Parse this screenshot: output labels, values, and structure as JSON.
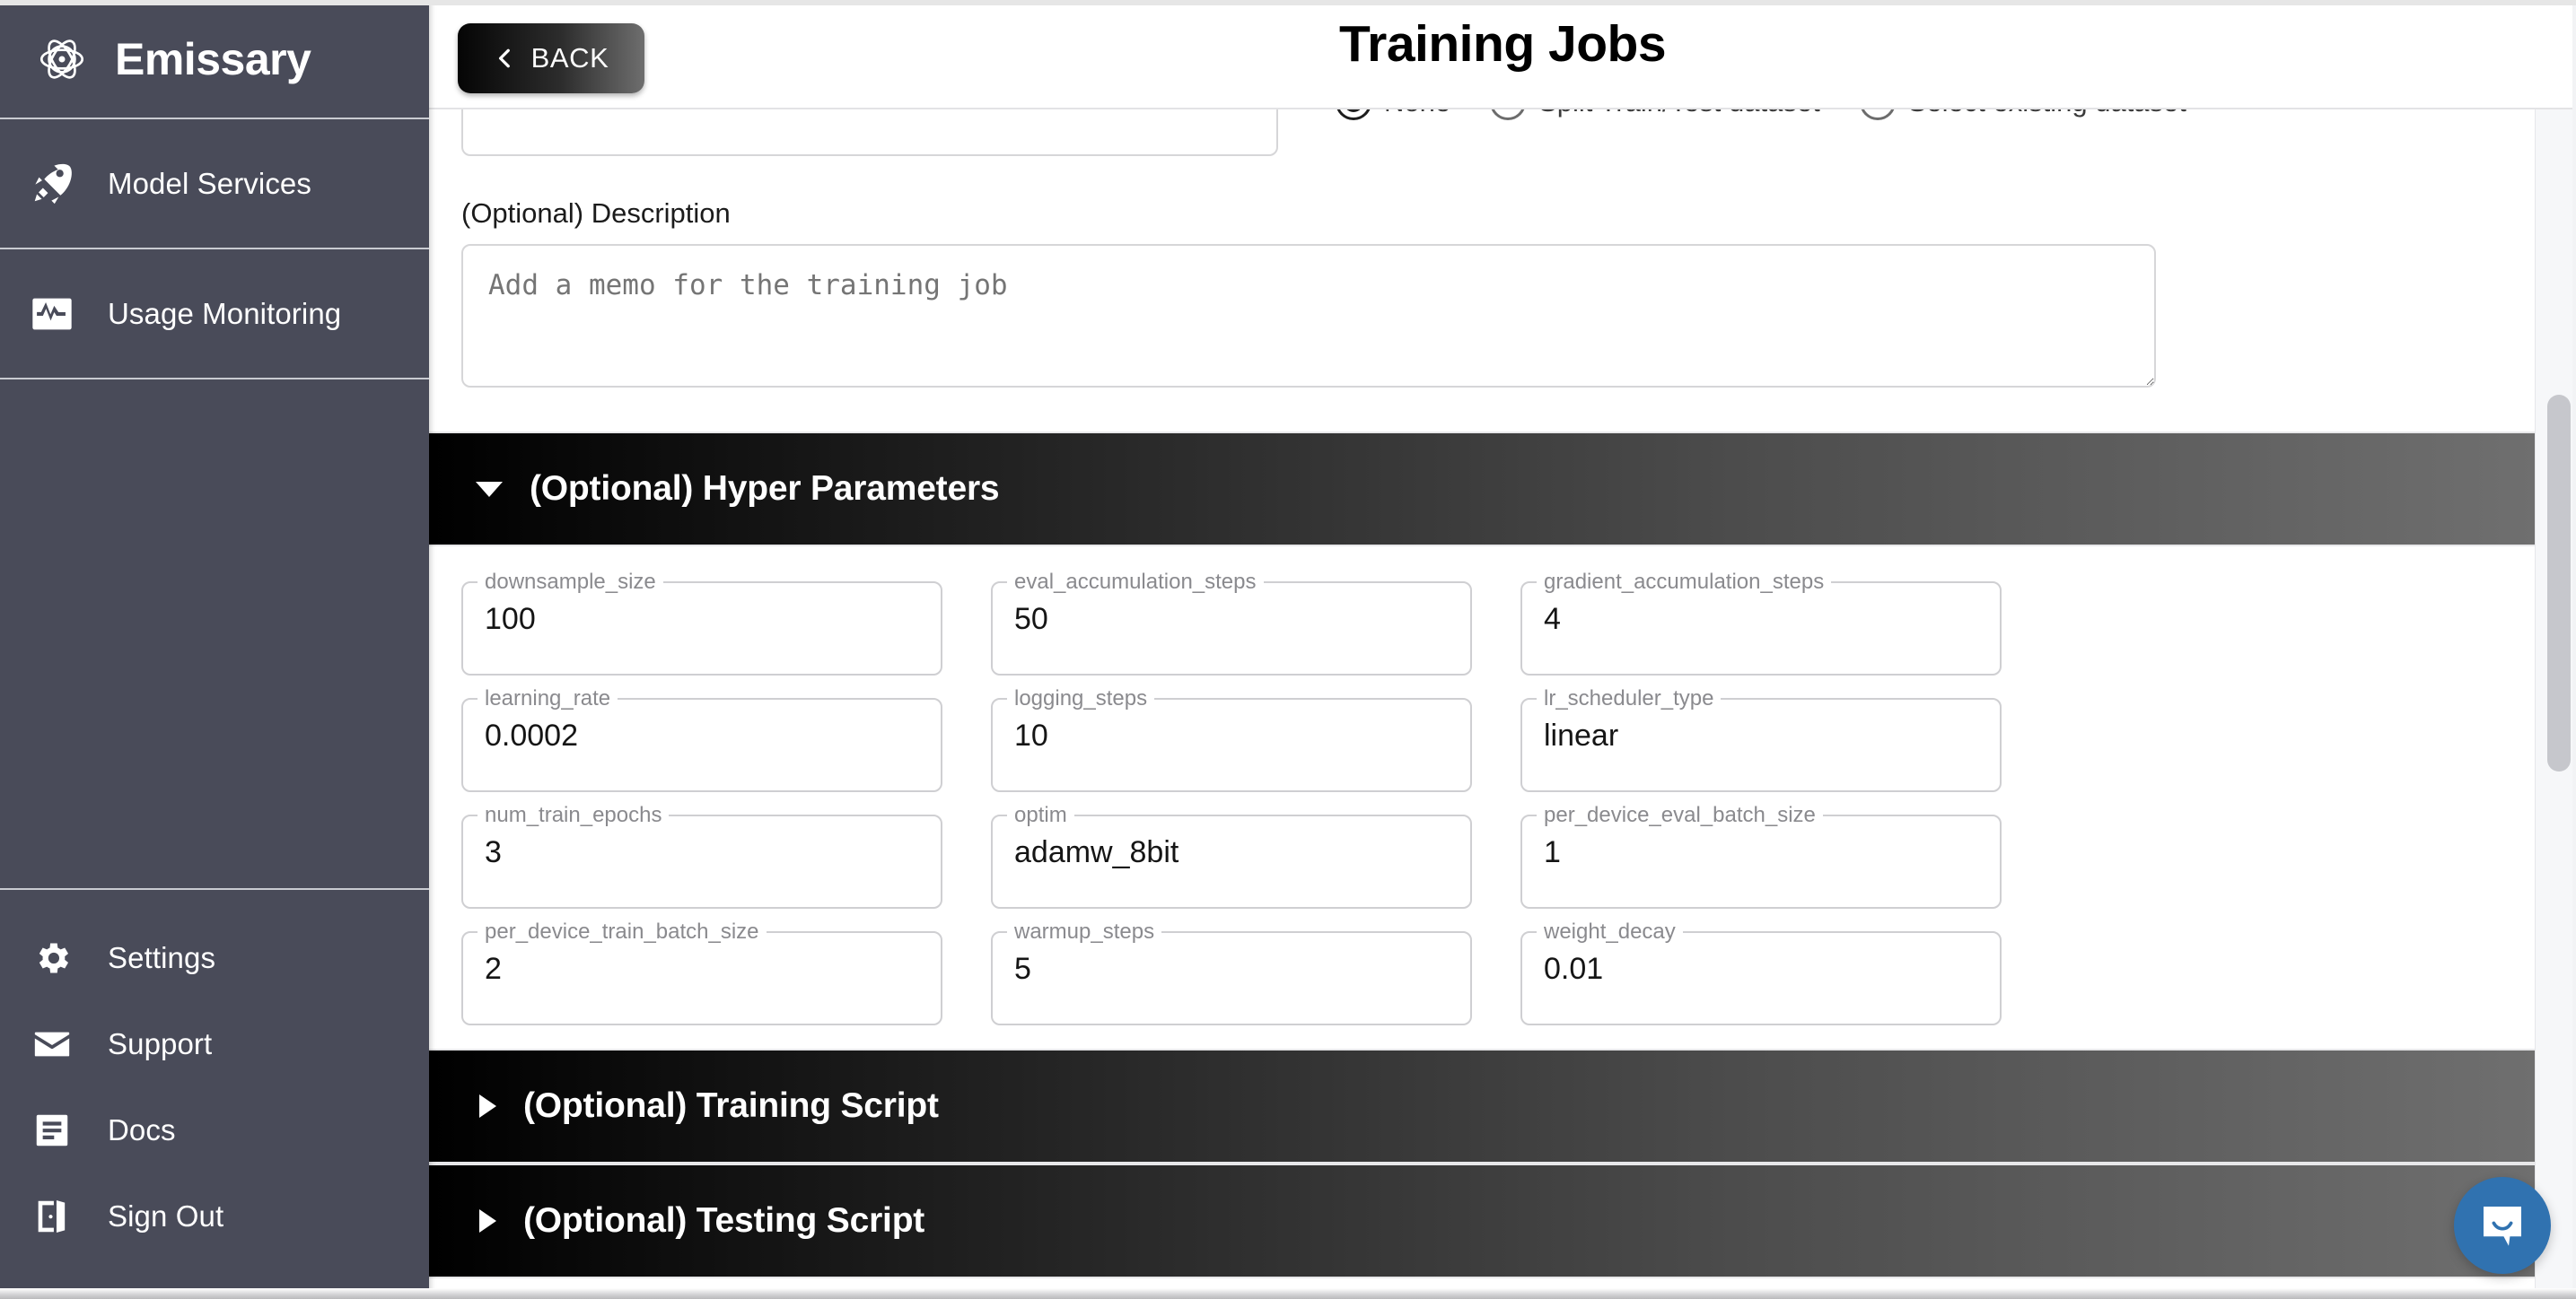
{
  "brand": {
    "name": "Emissary",
    "logo_icon": "atom-orbital-icon"
  },
  "sidebar": {
    "primary_items": [
      {
        "label": "Model Services",
        "icon": "rocket-icon"
      },
      {
        "label": "Usage Monitoring",
        "icon": "monitor-pulse-icon"
      }
    ],
    "secondary_items": [
      {
        "label": "Settings",
        "icon": "gear-icon"
      },
      {
        "label": "Support",
        "icon": "envelope-icon"
      },
      {
        "label": "Docs",
        "icon": "document-icon"
      },
      {
        "label": "Sign Out",
        "icon": "exit-door-icon"
      }
    ]
  },
  "topbar": {
    "back_label": "BACK",
    "back_icon": "chevron-left-icon",
    "title": "Training Jobs"
  },
  "dataset_options": {
    "select_value": "",
    "radios": [
      {
        "label": "None",
        "selected": true
      },
      {
        "label": "Split Train/Test dataset",
        "selected": false
      },
      {
        "label": "Select existing dataset",
        "selected": false
      }
    ]
  },
  "description": {
    "label": "(Optional) Description",
    "placeholder": "Add a memo for the training job",
    "value": ""
  },
  "sections": {
    "hyper_parameters": {
      "title": "(Optional) Hyper Parameters",
      "expanded": true,
      "fields": [
        {
          "label": "downsample_size",
          "value": "100"
        },
        {
          "label": "eval_accumulation_steps",
          "value": "50"
        },
        {
          "label": "gradient_accumulation_steps",
          "value": "4"
        },
        {
          "label": "learning_rate",
          "value": "0.0002"
        },
        {
          "label": "logging_steps",
          "value": "10"
        },
        {
          "label": "lr_scheduler_type",
          "value": "linear"
        },
        {
          "label": "num_train_epochs",
          "value": "3"
        },
        {
          "label": "optim",
          "value": "adamw_8bit"
        },
        {
          "label": "per_device_eval_batch_size",
          "value": "1"
        },
        {
          "label": "per_device_train_batch_size",
          "value": "2"
        },
        {
          "label": "warmup_steps",
          "value": "5"
        },
        {
          "label": "weight_decay",
          "value": "0.01"
        }
      ]
    },
    "training_script": {
      "title": "(Optional) Training Script",
      "expanded": false
    },
    "testing_script": {
      "title": "(Optional) Testing Script",
      "expanded": false
    }
  },
  "chat": {
    "icon": "chat-bubble-icon",
    "color": "#3072b0"
  },
  "colors": {
    "sidebar_bg": "#494b59",
    "accent_blue": "#3072b0",
    "header_gradient_start": "#000000",
    "header_gradient_end": "#6f6f6f"
  }
}
